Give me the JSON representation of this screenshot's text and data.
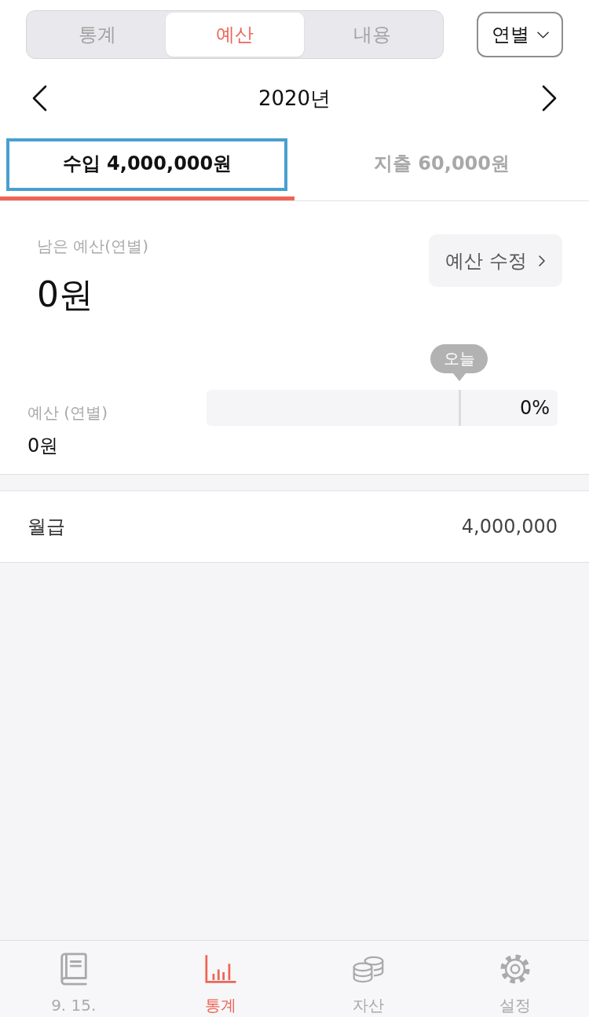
{
  "segmented_control": {
    "segments": [
      {
        "label": "통계",
        "selected": false
      },
      {
        "label": "예산",
        "selected": true
      },
      {
        "label": "내용",
        "selected": false
      }
    ]
  },
  "period_dropdown": {
    "label": "연별"
  },
  "year_nav": {
    "title": "2020년"
  },
  "tabs": [
    {
      "label": "수입 4,000,000원",
      "selected": true,
      "highlighted": true
    },
    {
      "label": "지출 60,000원",
      "selected": false,
      "highlighted": false
    }
  ],
  "summary": {
    "label": "남은 예산(연별)",
    "amount": "0원",
    "edit_button": "예산 수정"
  },
  "budget": {
    "label": "예산 (연별)",
    "amount": "0원",
    "today_label": "오늘",
    "progress": {
      "level": 0,
      "reading": "0%"
    }
  },
  "items": [
    {
      "name": "월급",
      "amount": "4,000,000"
    }
  ],
  "bottom_nav": [
    {
      "kind": "book",
      "label": "9. 15.",
      "selected": false
    },
    {
      "kind": "chart",
      "label": "통계",
      "selected": true
    },
    {
      "kind": "coins",
      "label": "자산",
      "selected": false
    },
    {
      "kind": "gear",
      "label": "설정",
      "selected": false
    }
  ]
}
